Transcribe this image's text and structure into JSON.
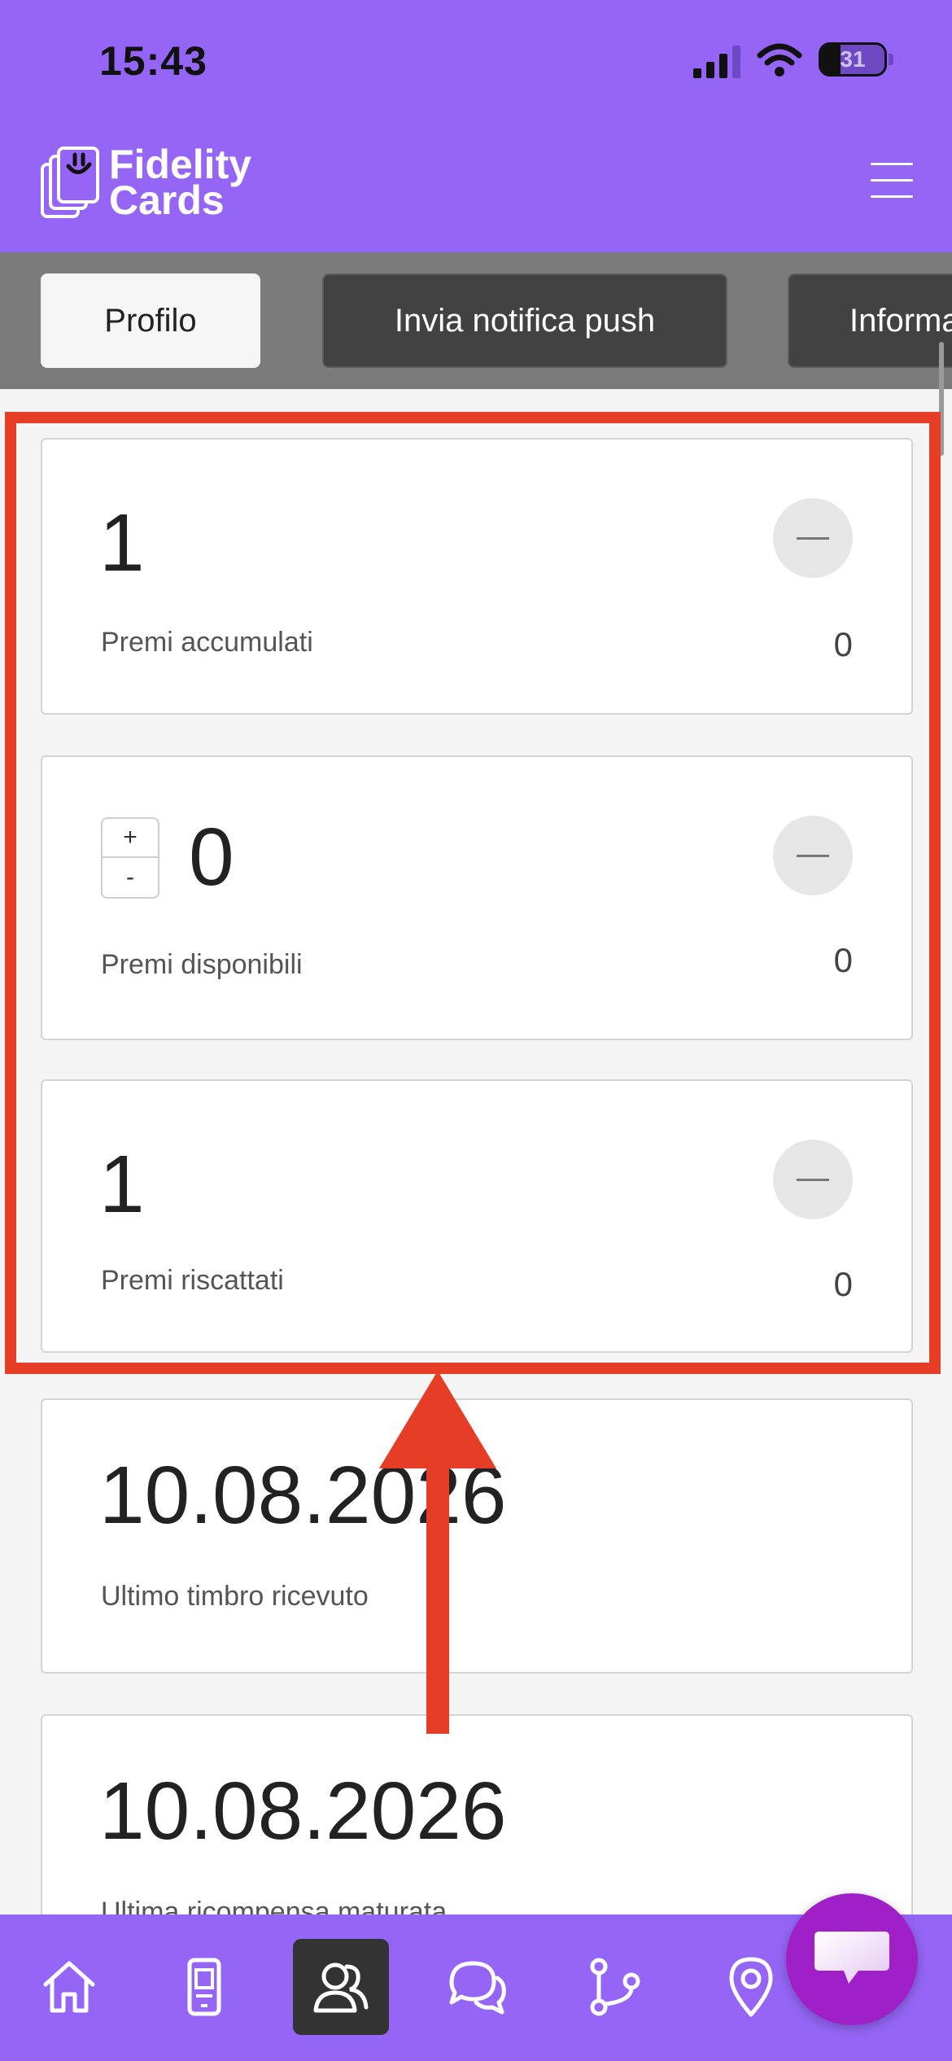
{
  "status_bar": {
    "time": "15:43",
    "battery": "31"
  },
  "header": {
    "logo_line1": "Fidelity",
    "logo_line2": "Cards"
  },
  "tabs": [
    {
      "label": "Profilo",
      "active": true
    },
    {
      "label": "Invia notifica push",
      "active": false
    },
    {
      "label": "Informa",
      "active": false
    }
  ],
  "cards": [
    {
      "value": "1",
      "label": "Premi accumulati",
      "side_value": "0"
    },
    {
      "value": "0",
      "label": "Premi disponibili",
      "side_value": "0",
      "stepper_plus": "+",
      "stepper_minus": "-"
    },
    {
      "value": "1",
      "label": "Premi riscattati",
      "side_value": "0"
    },
    {
      "value": "10.08.2026",
      "label": "Ultimo timbro ricevuto"
    },
    {
      "value": "10.08.2026",
      "label": "Ultima ricompensa maturata"
    }
  ],
  "bottom_nav": [
    "home-icon",
    "phone-icon",
    "users-icon",
    "chat-icon",
    "flow-icon",
    "location-icon"
  ],
  "colors": {
    "brand": "#9566f6",
    "annotation": "#e63d26",
    "chat_fab": "#a020c8"
  }
}
